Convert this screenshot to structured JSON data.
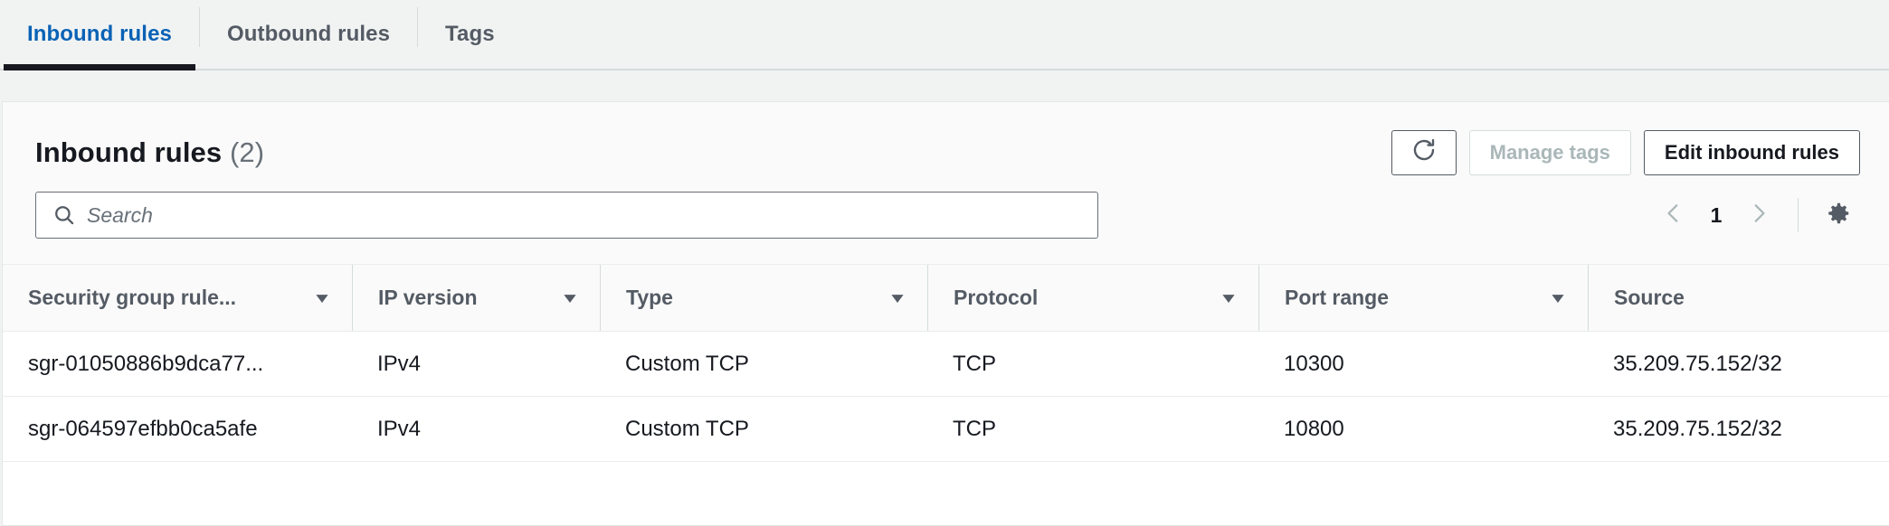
{
  "tabs": [
    {
      "label": "Inbound rules",
      "active": true
    },
    {
      "label": "Outbound rules",
      "active": false
    },
    {
      "label": "Tags",
      "active": false
    }
  ],
  "panel": {
    "title": "Inbound rules",
    "count": "(2)",
    "actions": {
      "refresh_icon": "refresh-icon",
      "manage_tags_label": "Manage tags",
      "edit_rules_label": "Edit inbound rules"
    },
    "search": {
      "placeholder": "Search",
      "value": "",
      "icon": "search-icon"
    },
    "pagination": {
      "prev_icon": "chevron-left-icon",
      "page": "1",
      "next_icon": "chevron-right-icon",
      "settings_icon": "gear-icon"
    }
  },
  "table": {
    "columns": [
      {
        "label": "Security group rule...",
        "sortable": true
      },
      {
        "label": "IP version",
        "sortable": true
      },
      {
        "label": "Type",
        "sortable": true
      },
      {
        "label": "Protocol",
        "sortable": true
      },
      {
        "label": "Port range",
        "sortable": true
      },
      {
        "label": "Source",
        "sortable": false
      }
    ],
    "rows": [
      {
        "rule_id": "sgr-01050886b9dca77...",
        "ip_version": "IPv4",
        "type": "Custom TCP",
        "protocol": "TCP",
        "port_range": "10300",
        "source": "35.209.75.152/32"
      },
      {
        "rule_id": "sgr-064597efbb0ca5afe",
        "ip_version": "IPv4",
        "type": "Custom TCP",
        "protocol": "TCP",
        "port_range": "10800",
        "source": "35.209.75.152/32"
      }
    ]
  },
  "colors": {
    "active_tab": "#0a62b5",
    "page_bg": "#f1f3f3",
    "panel_bg": "#ffffff",
    "header_bg": "#fafafa",
    "text": "#16191f",
    "muted": "#687078",
    "border": "#eaeded"
  }
}
